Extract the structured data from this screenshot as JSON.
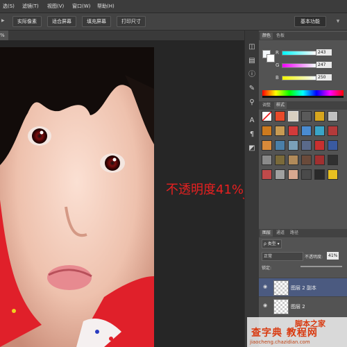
{
  "menubar": {
    "items": [
      "选(S)",
      "滤镜(T)",
      "视图(V)",
      "窗口(W)",
      "帮助(H)"
    ]
  },
  "optionsbar": {
    "buttons": [
      "实际像素",
      "适合屏幕",
      "填充屏幕",
      "打印尺寸"
    ],
    "workspace": "基本功能"
  },
  "document_tab": "%",
  "annotation": {
    "text": "不透明度41%",
    "color": "#e82020"
  },
  "color_panel": {
    "tabs": [
      "颜色",
      "色板"
    ],
    "channels": [
      {
        "label": "R",
        "value": "243"
      },
      {
        "label": "G",
        "value": "247"
      },
      {
        "label": "B",
        "value": "250"
      }
    ]
  },
  "styles_panel": {
    "tabs": [
      "调整",
      "样式"
    ]
  },
  "layers_panel": {
    "tabs": [
      "图层",
      "通道",
      "路径"
    ],
    "kind_filter": "类型",
    "blend_mode": "正常",
    "opacity_label": "不透明度:",
    "opacity_value": "41%",
    "lock_label": "锁定:",
    "layers": [
      {
        "name": "图层 2 副本",
        "selected": true
      },
      {
        "name": "图层 2",
        "selected": false
      }
    ]
  },
  "watermark": {
    "logo": "脚本之家",
    "main": "查字典 教程网",
    "url": "jiaocheng.chazidian.com"
  },
  "icons": {
    "close_tab": "close-icon",
    "eye": "eye-icon",
    "workspace_dropdown": "chevron-down-icon"
  }
}
